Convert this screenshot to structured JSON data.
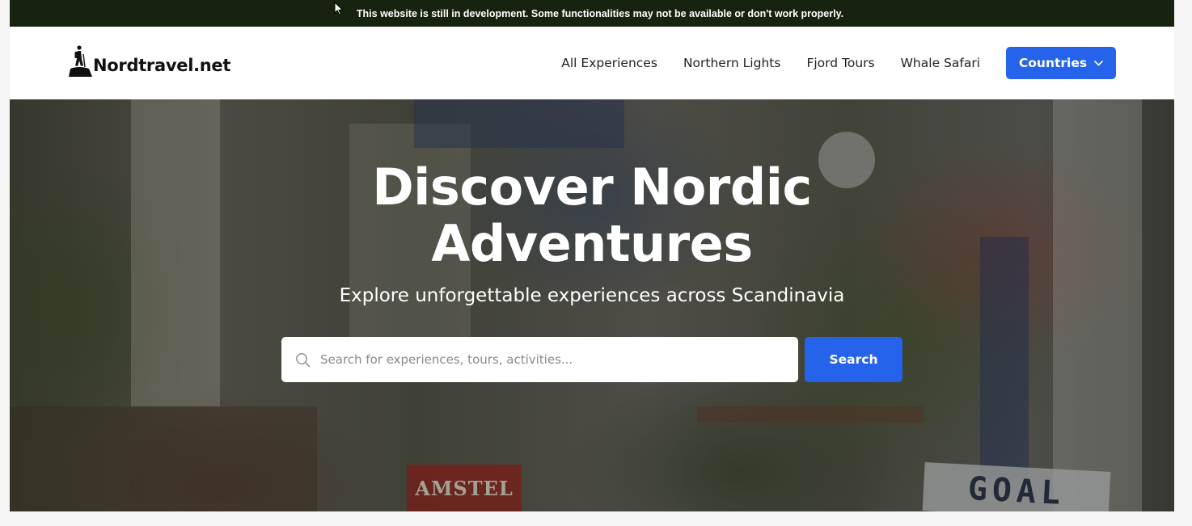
{
  "banner": {
    "text": "This website is still in development. Some functionalities may not be available or don't work properly."
  },
  "brand": {
    "logo_icon": "hiker-on-hill-icon",
    "name": "Nordtravel.net"
  },
  "nav": {
    "links": [
      {
        "label": "All Experiences"
      },
      {
        "label": "Northern Lights"
      },
      {
        "label": "Fjord Tours"
      },
      {
        "label": "Whale Safari"
      }
    ],
    "countries_label": "Countries",
    "countries_icon": "chevron-down-icon"
  },
  "hero": {
    "title_line1": "Discover Nordic",
    "title_line2": "Adventures",
    "subtitle": "Explore unforgettable experiences across Scandinavia",
    "search": {
      "icon": "search-icon",
      "placeholder": "Search for experiences, tours, activities...",
      "value": "",
      "button_label": "Search"
    },
    "background_signs": [
      "AMSTEL",
      "GOAL"
    ]
  },
  "colors": {
    "banner_bg": "#16240f",
    "accent": "#2563eb",
    "nav_bg": "#ffffff",
    "text_dark": "#222222",
    "hero_text": "#ffffff"
  }
}
